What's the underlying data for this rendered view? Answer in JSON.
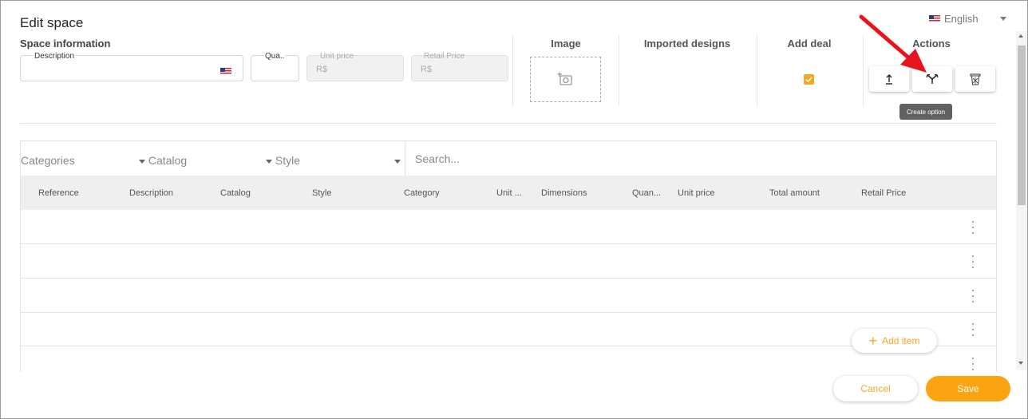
{
  "window": {
    "title": "Edit space"
  },
  "language": {
    "selected": "English"
  },
  "space_info": {
    "section_label": "Space information",
    "description": {
      "label": "Description",
      "value": ""
    },
    "quantity": {
      "label": "Qua..",
      "value": ""
    },
    "unit_price": {
      "label": "Unit price",
      "value": "R$"
    },
    "retail_price": {
      "label": "Retail Price",
      "value": "R$"
    }
  },
  "headers": {
    "image": "Image",
    "imported_designs": "Imported designs",
    "add_deal": "Add deal",
    "actions": "Actions"
  },
  "add_deal_checked": true,
  "actions": {
    "upload_icon": "upload-icon",
    "create_option_icon": "fork-icon",
    "delete_icon": "trash-icon",
    "tooltip": "Create option"
  },
  "filters": {
    "categories": "Categories",
    "catalog": "Catalog",
    "style": "Style",
    "search_placeholder": "Search..."
  },
  "table": {
    "columns": [
      "Reference",
      "Description",
      "Catalog",
      "Style",
      "Category",
      "Unit ...",
      "Dimensions",
      "Quan...",
      "Unit price",
      "Total amount",
      "Retail Price"
    ],
    "row_count": 5
  },
  "buttons": {
    "add_item": "Add item",
    "cancel": "Cancel",
    "save": "Save"
  },
  "colors": {
    "accent": "#fca311",
    "annotation_arrow": "#e8141c"
  }
}
